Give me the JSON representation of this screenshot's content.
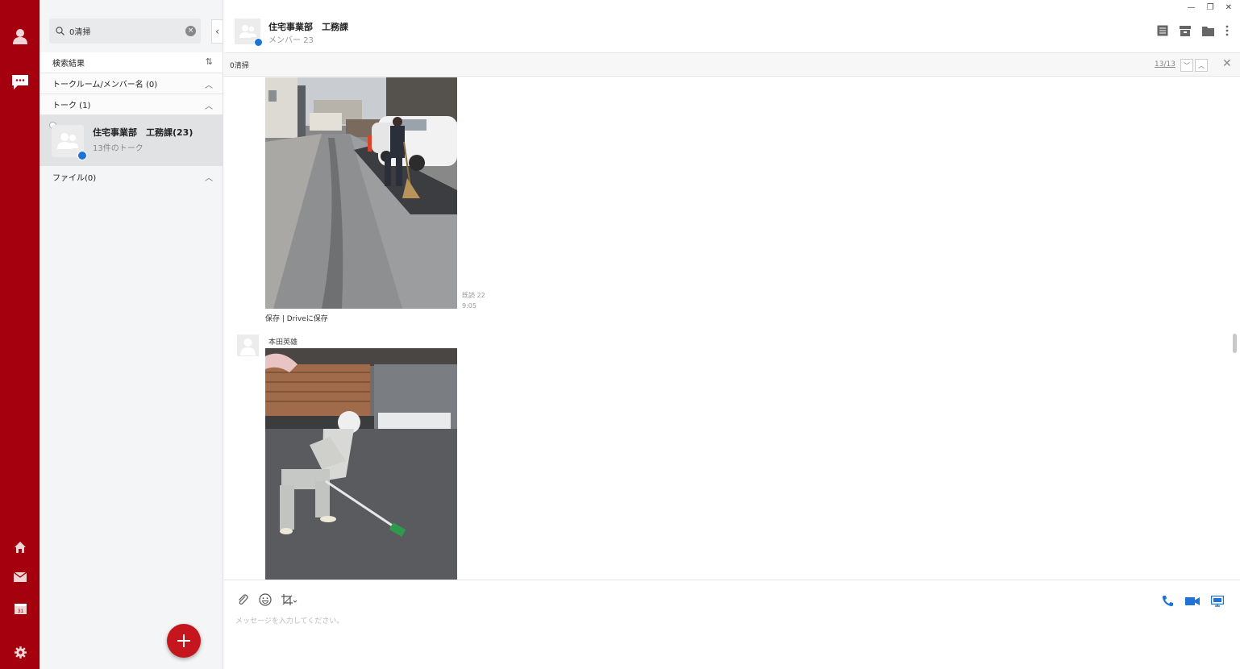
{
  "sidebar": {
    "search_value": "0清掃",
    "results_header": "検索結果",
    "sections": {
      "rooms": "トークルーム/メンバー名 (0)",
      "talks": "トーク (1)",
      "files": "ファイル(0)"
    },
    "result": {
      "title": "住宅事業部　工務課(23)",
      "subtitle": "13件のトーク"
    }
  },
  "header": {
    "title": "住宅事業部　工務課",
    "subtitle": "メンバー 23"
  },
  "search_bar": {
    "query": "0清掃",
    "counter": "13/13"
  },
  "messages": [
    {
      "read": "既読 22",
      "time": "9:05",
      "save_links": "保存 | Driveに保存"
    },
    {
      "sender": "本田英雄"
    }
  ],
  "composer": {
    "placeholder": "メッセージを入力してください。"
  },
  "colors": {
    "rail": "#a5000d",
    "accent_blue": "#1e73d6",
    "fab": "#c4161c"
  },
  "icons": [
    "profile-icon",
    "chat-icon",
    "home-icon",
    "mail-icon",
    "calendar-icon",
    "settings-icon",
    "search-icon",
    "clear-icon",
    "sort-icon",
    "note-icon",
    "album-icon",
    "folder-icon",
    "more-icon",
    "attach-icon",
    "emoji-icon",
    "screenshot-icon",
    "phone-icon",
    "video-icon",
    "screen-share-icon"
  ]
}
